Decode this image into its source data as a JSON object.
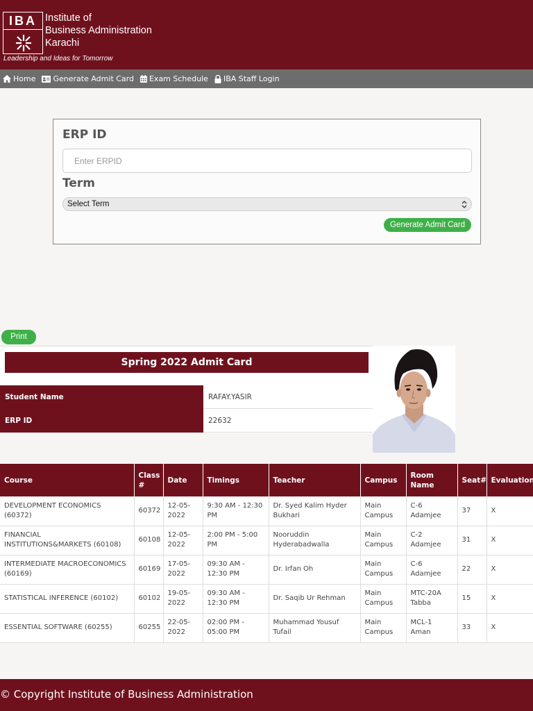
{
  "header": {
    "logo_text": "IBA",
    "inst_lines": [
      "Institute of",
      "Business Administration",
      "Karachi"
    ],
    "tagline": "Leadership and Ideas for Tomorrow"
  },
  "nav": {
    "items": [
      {
        "label": "Home",
        "icon": "home-icon"
      },
      {
        "label": "Generate Admit Card",
        "icon": "id-card-icon"
      },
      {
        "label": "Exam Schedule",
        "icon": "calendar-icon"
      },
      {
        "label": "IBA Staff Login",
        "icon": "lock-icon"
      }
    ]
  },
  "form": {
    "erp_label": "ERP ID",
    "erp_placeholder": "Enter ERPID",
    "term_label": "Term",
    "term_selected": "Select Term",
    "submit_label": "Generate Admit Card"
  },
  "print_label": "Print",
  "admit": {
    "title": "Spring 2022 Admit Card",
    "student_name_label": "Student Name",
    "student_name": "RAFAY.YASIR",
    "erp_label": "ERP ID",
    "erp": "22632"
  },
  "table": {
    "headers": [
      "Course",
      "Class #",
      "Date",
      "Timings",
      "Teacher",
      "Campus",
      "Room Name",
      "Seat#",
      "Evaluation"
    ],
    "rows": [
      [
        "DEVELOPMENT ECONOMICS (60372)",
        "60372",
        "12-05-2022",
        "9:30 AM - 12:30 PM",
        "Dr. Syed Kalim Hyder Bukhari",
        "Main Campus",
        "C-6 Adamjee",
        "37",
        "X"
      ],
      [
        "FINANCIAL INSTITUTIONS&MARKETS (60108)",
        "60108",
        "12-05-2022",
        "2:00 PM - 5:00 PM",
        "Nooruddin Hyderabadwalla",
        "Main Campus",
        "C-2 Adamjee",
        "31",
        "X"
      ],
      [
        "INTERMEDIATE MACROECONOMICS (60169)",
        "60169",
        "17-05-2022",
        "09:30 AM - 12:30 PM",
        "Dr. Irfan Oh",
        "Main Campus",
        "C-6 Adamjee",
        "22",
        "X"
      ],
      [
        "STATISTICAL INFERENCE (60102)",
        "60102",
        "19-05-2022",
        "09:30 AM - 12:30 PM",
        "Dr. Saqib Ur Rehman",
        "Main Campus",
        "MTC-20A Tabba",
        "15",
        "X"
      ],
      [
        "ESSENTIAL SOFTWARE (60255)",
        "60255",
        "22-05-2022",
        "02:00 PM - 05:00 PM",
        "Muhammad Yousuf Tufail",
        "Main Campus",
        "MCL-1 Aman",
        "33",
        "X"
      ]
    ]
  },
  "footer": "© Copyright Institute of Business Administration",
  "colors": {
    "maroon": "#6f111d",
    "green": "#3fb049",
    "nav_gray": "#6d6d6d"
  }
}
